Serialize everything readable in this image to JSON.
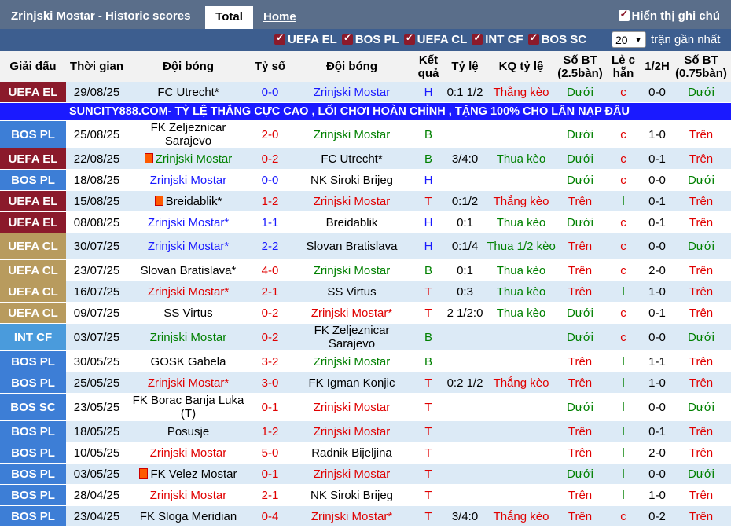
{
  "header": {
    "title": "Zrinjski Mostar - Historic scores",
    "tab_total": "Total",
    "tab_home": "Home",
    "show_all": "Hiển thị ghi chú"
  },
  "filters": {
    "items": [
      "UEFA EL",
      "BOS PL",
      "UEFA CL",
      "INT CF",
      "BOS SC"
    ],
    "count_value": "20",
    "recent_label": "trận gần nhất"
  },
  "columns": [
    "Giải đấu",
    "Thời gian",
    "Đội bóng",
    "Tỷ số",
    "Đội bóng",
    "Kết quả",
    "Tỷ lệ",
    "KQ tỷ lệ",
    "Số BT (2.5bàn)",
    "Lẻ c hẵn",
    "1/2H",
    "Số BT (0.75bàn)"
  ],
  "ad_text": "SUNCITY888.COM- TỶ LỆ THẮNG CỰC CAO , LỐI CHƠI HOÀN CHỈNH , TẶNG 100% CHO LẦN NẠP ĐẦU",
  "colors": {
    "UEFA EL": "#8b1a2b",
    "BOS PL": "#3d7ed6",
    "UEFA CL": "#b89b5e",
    "INT CF": "#4a9bdc",
    "BOS SC": "#3d7ed6"
  },
  "rows": [
    {
      "comp": "UEFA EL",
      "date": "29/08/25",
      "home": "FC Utrecht*",
      "home_color": "black",
      "home_flag": false,
      "score": "0-0",
      "score_color": "blue",
      "away": "Zrinjski Mostar",
      "away_color": "blue",
      "away_flag": false,
      "res": "H",
      "res_color": "blue",
      "odds": "0:1 1/2",
      "oddsres": "Thắng kèo",
      "oddsres_color": "red",
      "bt25": "Dưới",
      "bt25_color": "green",
      "oe": "c",
      "oe_color": "red",
      "ht": "0-0",
      "bt075": "Dưới",
      "bt075_color": "green"
    },
    {
      "comp": "BOS PL",
      "date": "25/08/25",
      "home": "FK Zeljeznicar Sarajevo",
      "home_color": "black",
      "home_flag": false,
      "score": "2-0",
      "score_color": "red",
      "away": "Zrinjski Mostar",
      "away_color": "green",
      "away_flag": false,
      "res": "B",
      "res_color": "green",
      "odds": "",
      "oddsres": "",
      "oddsres_color": "black",
      "bt25": "Dưới",
      "bt25_color": "green",
      "oe": "c",
      "oe_color": "red",
      "ht": "1-0",
      "bt075": "Trên",
      "bt075_color": "red"
    },
    {
      "comp": "UEFA EL",
      "date": "22/08/25",
      "home": "Zrinjski Mostar",
      "home_color": "green",
      "home_flag": true,
      "score": "0-2",
      "score_color": "red",
      "away": "FC Utrecht*",
      "away_color": "black",
      "away_flag": false,
      "res": "B",
      "res_color": "green",
      "odds": "3/4:0",
      "oddsres": "Thua kèo",
      "oddsres_color": "green",
      "bt25": "Dưới",
      "bt25_color": "green",
      "oe": "c",
      "oe_color": "red",
      "ht": "0-1",
      "bt075": "Trên",
      "bt075_color": "red"
    },
    {
      "comp": "BOS PL",
      "date": "18/08/25",
      "home": "Zrinjski Mostar",
      "home_color": "blue",
      "home_flag": false,
      "score": "0-0",
      "score_color": "blue",
      "away": "NK Siroki Brijeg",
      "away_color": "black",
      "away_flag": false,
      "res": "H",
      "res_color": "blue",
      "odds": "",
      "oddsres": "",
      "oddsres_color": "black",
      "bt25": "Dưới",
      "bt25_color": "green",
      "oe": "c",
      "oe_color": "red",
      "ht": "0-0",
      "bt075": "Dưới",
      "bt075_color": "green"
    },
    {
      "comp": "UEFA EL",
      "date": "15/08/25",
      "home": "Breidablik*",
      "home_color": "black",
      "home_flag": true,
      "score": "1-2",
      "score_color": "red",
      "away": "Zrinjski Mostar",
      "away_color": "red",
      "away_flag": false,
      "res": "T",
      "res_color": "red",
      "odds": "0:1/2",
      "oddsres": "Thắng kèo",
      "oddsres_color": "red",
      "bt25": "Trên",
      "bt25_color": "red",
      "oe": "l",
      "oe_color": "green",
      "ht": "0-1",
      "bt075": "Trên",
      "bt075_color": "red"
    },
    {
      "comp": "UEFA EL",
      "date": "08/08/25",
      "home": "Zrinjski Mostar*",
      "home_color": "blue",
      "home_flag": false,
      "score": "1-1",
      "score_color": "blue",
      "away": "Breidablik",
      "away_color": "black",
      "away_flag": false,
      "res": "H",
      "res_color": "blue",
      "odds": "0:1",
      "oddsres": "Thua kèo",
      "oddsres_color": "green",
      "bt25": "Dưới",
      "bt25_color": "green",
      "oe": "c",
      "oe_color": "red",
      "ht": "0-1",
      "bt075": "Trên",
      "bt075_color": "red"
    },
    {
      "comp": "UEFA CL",
      "date": "30/07/25",
      "home": "Zrinjski Mostar*",
      "home_color": "blue",
      "home_flag": false,
      "score": "2-2",
      "score_color": "blue",
      "away": "Slovan Bratislava",
      "away_color": "black",
      "away_flag": false,
      "res": "H",
      "res_color": "blue",
      "odds": "0:1/4",
      "oddsres": "Thua 1/2 kèo",
      "oddsres_color": "green",
      "bt25": "Trên",
      "bt25_color": "red",
      "oe": "c",
      "oe_color": "red",
      "ht": "0-0",
      "bt075": "Dưới",
      "bt075_color": "green",
      "tall": true
    },
    {
      "comp": "UEFA CL",
      "date": "23/07/25",
      "home": "Slovan Bratislava*",
      "home_color": "black",
      "home_flag": false,
      "score": "4-0",
      "score_color": "red",
      "away": "Zrinjski Mostar",
      "away_color": "green",
      "away_flag": false,
      "res": "B",
      "res_color": "green",
      "odds": "0:1",
      "oddsres": "Thua kèo",
      "oddsres_color": "green",
      "bt25": "Trên",
      "bt25_color": "red",
      "oe": "c",
      "oe_color": "red",
      "ht": "2-0",
      "bt075": "Trên",
      "bt075_color": "red"
    },
    {
      "comp": "UEFA CL",
      "date": "16/07/25",
      "home": "Zrinjski Mostar*",
      "home_color": "red",
      "home_flag": false,
      "score": "2-1",
      "score_color": "red",
      "away": "SS Virtus",
      "away_color": "black",
      "away_flag": false,
      "res": "T",
      "res_color": "red",
      "odds": "0:3",
      "oddsres": "Thua kèo",
      "oddsres_color": "green",
      "bt25": "Trên",
      "bt25_color": "red",
      "oe": "l",
      "oe_color": "green",
      "ht": "1-0",
      "bt075": "Trên",
      "bt075_color": "red"
    },
    {
      "comp": "UEFA CL",
      "date": "09/07/25",
      "home": "SS Virtus",
      "home_color": "black",
      "home_flag": false,
      "score": "0-2",
      "score_color": "red",
      "away": "Zrinjski Mostar*",
      "away_color": "red",
      "away_flag": false,
      "res": "T",
      "res_color": "red",
      "odds": "2 1/2:0",
      "oddsres": "Thua kèo",
      "oddsres_color": "green",
      "bt25": "Dưới",
      "bt25_color": "green",
      "oe": "c",
      "oe_color": "red",
      "ht": "0-1",
      "bt075": "Trên",
      "bt075_color": "red"
    },
    {
      "comp": "INT CF",
      "date": "03/07/25",
      "home": "Zrinjski Mostar",
      "home_color": "green",
      "home_flag": false,
      "score": "0-2",
      "score_color": "red",
      "away": "FK Zeljeznicar Sarajevo",
      "away_color": "black",
      "away_flag": false,
      "res": "B",
      "res_color": "green",
      "odds": "",
      "oddsres": "",
      "oddsres_color": "black",
      "bt25": "Dưới",
      "bt25_color": "green",
      "oe": "c",
      "oe_color": "red",
      "ht": "0-0",
      "bt075": "Dưới",
      "bt075_color": "green",
      "tall": true
    },
    {
      "comp": "BOS PL",
      "date": "30/05/25",
      "home": "GOSK Gabela",
      "home_color": "black",
      "home_flag": false,
      "score": "3-2",
      "score_color": "red",
      "away": "Zrinjski Mostar",
      "away_color": "green",
      "away_flag": false,
      "res": "B",
      "res_color": "green",
      "odds": "",
      "oddsres": "",
      "oddsres_color": "black",
      "bt25": "Trên",
      "bt25_color": "red",
      "oe": "l",
      "oe_color": "green",
      "ht": "1-1",
      "bt075": "Trên",
      "bt075_color": "red"
    },
    {
      "comp": "BOS PL",
      "date": "25/05/25",
      "home": "Zrinjski Mostar*",
      "home_color": "red",
      "home_flag": false,
      "score": "3-0",
      "score_color": "red",
      "away": "FK Igman Konjic",
      "away_color": "black",
      "away_flag": false,
      "res": "T",
      "res_color": "red",
      "odds": "0:2 1/2",
      "oddsres": "Thắng kèo",
      "oddsres_color": "red",
      "bt25": "Trên",
      "bt25_color": "red",
      "oe": "l",
      "oe_color": "green",
      "ht": "1-0",
      "bt075": "Trên",
      "bt075_color": "red"
    },
    {
      "comp": "BOS SC",
      "date": "23/05/25",
      "home": "FK Borac Banja Luka (T)",
      "home_color": "black",
      "home_flag": false,
      "score": "0-1",
      "score_color": "red",
      "away": "Zrinjski Mostar",
      "away_color": "red",
      "away_flag": false,
      "res": "T",
      "res_color": "red",
      "odds": "",
      "oddsres": "",
      "oddsres_color": "black",
      "bt25": "Dưới",
      "bt25_color": "green",
      "oe": "l",
      "oe_color": "green",
      "ht": "0-0",
      "bt075": "Dưới",
      "bt075_color": "green",
      "tall": true
    },
    {
      "comp": "BOS PL",
      "date": "18/05/25",
      "home": "Posusje",
      "home_color": "black",
      "home_flag": false,
      "score": "1-2",
      "score_color": "red",
      "away": "Zrinjski Mostar",
      "away_color": "red",
      "away_flag": false,
      "res": "T",
      "res_color": "red",
      "odds": "",
      "oddsres": "",
      "oddsres_color": "black",
      "bt25": "Trên",
      "bt25_color": "red",
      "oe": "l",
      "oe_color": "green",
      "ht": "0-1",
      "bt075": "Trên",
      "bt075_color": "red"
    },
    {
      "comp": "BOS PL",
      "date": "10/05/25",
      "home": "Zrinjski Mostar",
      "home_color": "red",
      "home_flag": false,
      "score": "5-0",
      "score_color": "red",
      "away": "Radnik Bijeljina",
      "away_color": "black",
      "away_flag": false,
      "res": "T",
      "res_color": "red",
      "odds": "",
      "oddsres": "",
      "oddsres_color": "black",
      "bt25": "Trên",
      "bt25_color": "red",
      "oe": "l",
      "oe_color": "green",
      "ht": "2-0",
      "bt075": "Trên",
      "bt075_color": "red"
    },
    {
      "comp": "BOS PL",
      "date": "03/05/25",
      "home": "FK Velez Mostar",
      "home_color": "black",
      "home_flag": true,
      "score": "0-1",
      "score_color": "red",
      "away": "Zrinjski Mostar",
      "away_color": "red",
      "away_flag": false,
      "res": "T",
      "res_color": "red",
      "odds": "",
      "oddsres": "",
      "oddsres_color": "black",
      "bt25": "Dưới",
      "bt25_color": "green",
      "oe": "l",
      "oe_color": "green",
      "ht": "0-0",
      "bt075": "Dưới",
      "bt075_color": "green"
    },
    {
      "comp": "BOS PL",
      "date": "28/04/25",
      "home": "Zrinjski Mostar",
      "home_color": "red",
      "home_flag": false,
      "score": "2-1",
      "score_color": "red",
      "away": "NK Siroki Brijeg",
      "away_color": "black",
      "away_flag": false,
      "res": "T",
      "res_color": "red",
      "odds": "",
      "oddsres": "",
      "oddsres_color": "black",
      "bt25": "Trên",
      "bt25_color": "red",
      "oe": "l",
      "oe_color": "green",
      "ht": "1-0",
      "bt075": "Trên",
      "bt075_color": "red"
    },
    {
      "comp": "BOS PL",
      "date": "23/04/25",
      "home": "FK Sloga Meridian",
      "home_color": "black",
      "home_flag": false,
      "score": "0-4",
      "score_color": "red",
      "away": "Zrinjski Mostar*",
      "away_color": "red",
      "away_flag": false,
      "res": "T",
      "res_color": "red",
      "odds": "3/4:0",
      "oddsres": "Thắng kèo",
      "oddsres_color": "red",
      "bt25": "Trên",
      "bt25_color": "red",
      "oe": "c",
      "oe_color": "red",
      "ht": "0-2",
      "bt075": "Trên",
      "bt075_color": "red"
    }
  ]
}
